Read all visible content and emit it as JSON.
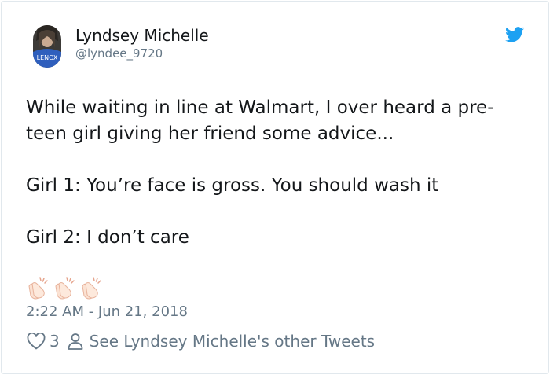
{
  "user": {
    "display_name": "Lyndsey Michelle",
    "handle": "@lyndee_9720",
    "avatar_shirt_text": "LENOX"
  },
  "tweet": {
    "lines": [
      "While waiting in line at Walmart, I over heard a pre-",
      "teen girl giving her friend some advice...",
      "",
      "Girl 1: You’re face is gross. You should wash it",
      "",
      "Girl 2: I don’t care"
    ],
    "emoji": [
      "clapping-hands",
      "clapping-hands",
      "clapping-hands"
    ],
    "timestamp": "2:22 AM - Jun 21, 2018"
  },
  "actions": {
    "like_count": "3",
    "profile_link": "See Lyndsey Michelle's other Tweets"
  },
  "colors": {
    "twitter_blue": "#1da1f2",
    "text_primary": "#14171a",
    "text_secondary": "#657786",
    "border": "#e1e8ed"
  }
}
